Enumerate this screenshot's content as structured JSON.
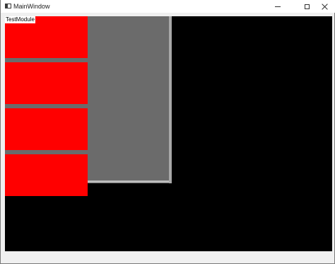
{
  "window": {
    "title": "MainWindow"
  },
  "module": {
    "label": "TestModule",
    "blocks": [
      {
        "color": "#ff0000"
      },
      {
        "color": "#ff0000"
      },
      {
        "color": "#ff0000"
      },
      {
        "color": "#ff0000"
      }
    ]
  },
  "colors": {
    "viewport_background": "#000000",
    "panel": "#6b6b6b",
    "block": "#ff0000"
  },
  "icons": {
    "app": "window-app-icon",
    "minimize": "minimize-icon",
    "maximize": "maximize-icon",
    "close": "close-icon"
  }
}
